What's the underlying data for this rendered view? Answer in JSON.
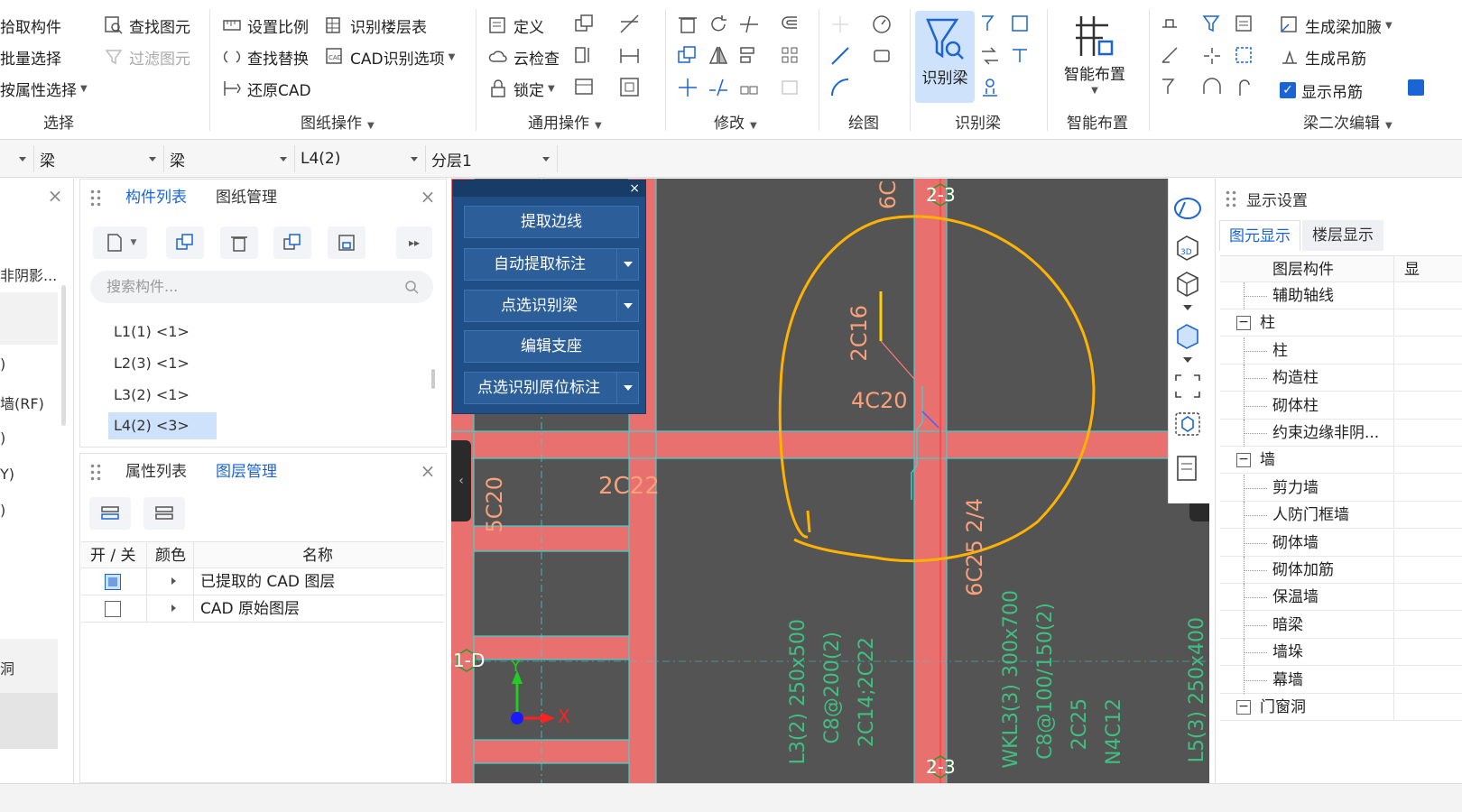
{
  "ribbon": {
    "select_group": {
      "label": "选择",
      "pick": "拾取构件",
      "batch": "批量选择",
      "by_attr": "按属性选择",
      "find": "查找图元",
      "filter": "过滤图元"
    },
    "drawing_group": {
      "label": "图纸操作",
      "set_scale": "设置比例",
      "find_replace": "查找替换",
      "restore_cad": "还原CAD",
      "identify_floor_table": "识别楼层表",
      "cad_options": "CAD识别选项"
    },
    "common_group": {
      "label": "通用操作",
      "define": "定义",
      "cloud_check": "云检查",
      "lock": "锁定"
    },
    "modify_group": {
      "label": "修改"
    },
    "draw_group": {
      "label": "绘图"
    },
    "identify_beam_group": {
      "label": "识别梁",
      "big_button": "识别梁"
    },
    "smart_layout_group": {
      "label": "智能布置",
      "big_button": "智能布置"
    },
    "beam_edit_group": {
      "label": "梁二次编辑",
      "gen_haunch": "生成梁加腋",
      "gen_hanger": "生成吊筋",
      "show_hanger": "显示吊筋"
    }
  },
  "optbar": {
    "dd1": "梁",
    "dd2": "梁",
    "dd3": "L4(2)",
    "dd4": "分层1"
  },
  "left_partial": {
    "items": [
      "非阴影...",
      ")",
      "墙(RF)",
      ")",
      "Y)",
      ")",
      "洞"
    ]
  },
  "component_panel": {
    "tabs": [
      "构件列表",
      "图纸管理"
    ],
    "search_placeholder": "搜索构件...",
    "items": [
      "L1(1) <1>",
      "L2(3) <1>",
      "L3(2) <1>",
      "L4(2) <3>"
    ]
  },
  "layer_panel": {
    "tabs": [
      "属性列表",
      "图层管理"
    ],
    "headers": [
      "开 / 关",
      "颜色",
      "名称"
    ],
    "rows": [
      {
        "name": "已提取的 CAD 图层",
        "on": true
      },
      {
        "name": "CAD 原始图层",
        "on": false
      }
    ]
  },
  "cad_float": {
    "buttons": [
      "提取边线",
      "自动提取标注",
      "点选识别梁",
      "编辑支座",
      "点选识别原位标注"
    ]
  },
  "canvas": {
    "labels": {
      "axis_top": "2-3",
      "axis_bottom": "2-3",
      "axis_left": "1-D",
      "top_cut": "6C",
      "rebar_2c16": "2C16",
      "rebar_4c20": "4C20",
      "rebar_2c22": "2C22",
      "rebar_5c20": "5C20",
      "rebar_6c25": "6C25 2/4",
      "beam_l3": "L3(2) 250x500",
      "beam_l3b": "C8@200(2)",
      "beam_l3c": "2C14;2C22",
      "beam_wkl": "WKL3(3) 300x700",
      "beam_wklb": "C8@100/150(2)",
      "beam_wklc": "2C25",
      "beam_wkld": "N4C12",
      "beam_right": "L5(3) 250x400",
      "ucs_x": "X",
      "ucs_y": "Y"
    },
    "colors": {
      "bg": "#545454",
      "beam": "#e8706e",
      "cyan": "#3fd0d0",
      "annot": "#f8a07a",
      "highlight": "#ffb300"
    }
  },
  "display_panel": {
    "title": "显示设置",
    "tabs": [
      "图元显示",
      "楼层显示"
    ],
    "header": "图层构件",
    "header2": "显",
    "rows": [
      {
        "label": "辅助轴线",
        "level": 2
      },
      {
        "label": "柱",
        "level": 1,
        "toggle": "−"
      },
      {
        "label": "柱",
        "level": 2
      },
      {
        "label": "构造柱",
        "level": 2
      },
      {
        "label": "砌体柱",
        "level": 2
      },
      {
        "label": "约束边缘非阴...",
        "level": 2
      },
      {
        "label": "墙",
        "level": 1,
        "toggle": "−"
      },
      {
        "label": "剪力墙",
        "level": 2
      },
      {
        "label": "人防门框墙",
        "level": 2
      },
      {
        "label": "砌体墙",
        "level": 2
      },
      {
        "label": "砌体加筋",
        "level": 2
      },
      {
        "label": "保温墙",
        "level": 2
      },
      {
        "label": "暗梁",
        "level": 2
      },
      {
        "label": "墙垛",
        "level": 2
      },
      {
        "label": "幕墙",
        "level": 2
      },
      {
        "label": "门窗洞",
        "level": 1,
        "toggle": "−"
      }
    ]
  }
}
